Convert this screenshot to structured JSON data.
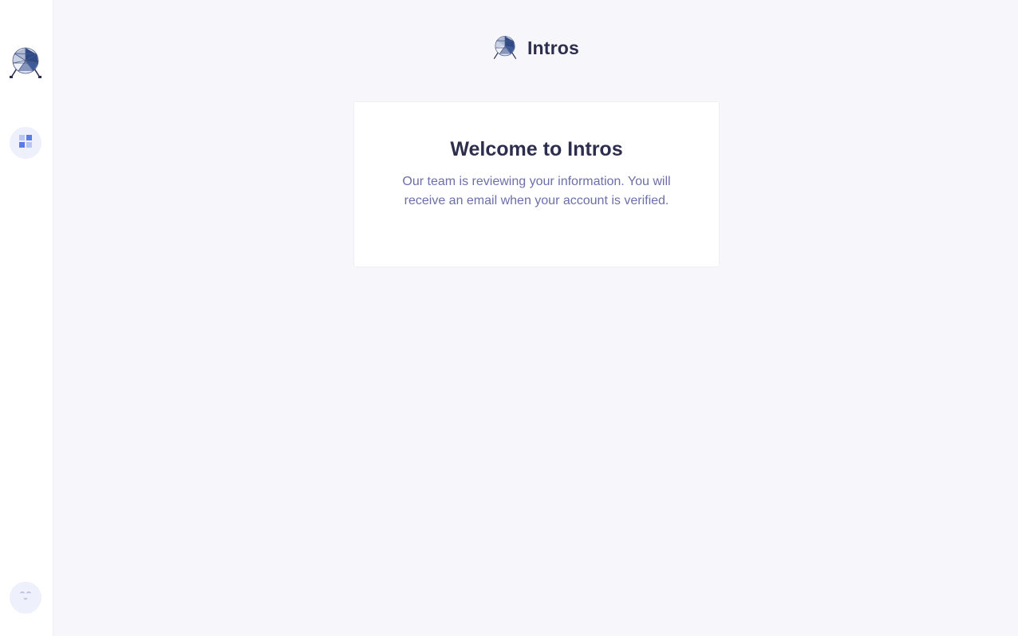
{
  "sidebar": {
    "logo_icon": "geodesic-logo-icon",
    "nav": [
      {
        "name": "dashboard",
        "icon": "dashboard-grid-icon",
        "active": true
      }
    ],
    "avatar_icon": "face-avatar-icon"
  },
  "header": {
    "brand_name": "Intros",
    "logo_icon": "geodesic-logo-icon"
  },
  "card": {
    "title": "Welcome to Intros",
    "message": "Our team is reviewing your information. You will receive an email when your account is verified."
  },
  "colors": {
    "background": "#f7f7fb",
    "sidebar": "#ffffff",
    "title_text": "#2d2e4e",
    "body_text": "#6c6fa8",
    "accent": "#5b7be8",
    "icon_bg": "#eef0fb"
  }
}
